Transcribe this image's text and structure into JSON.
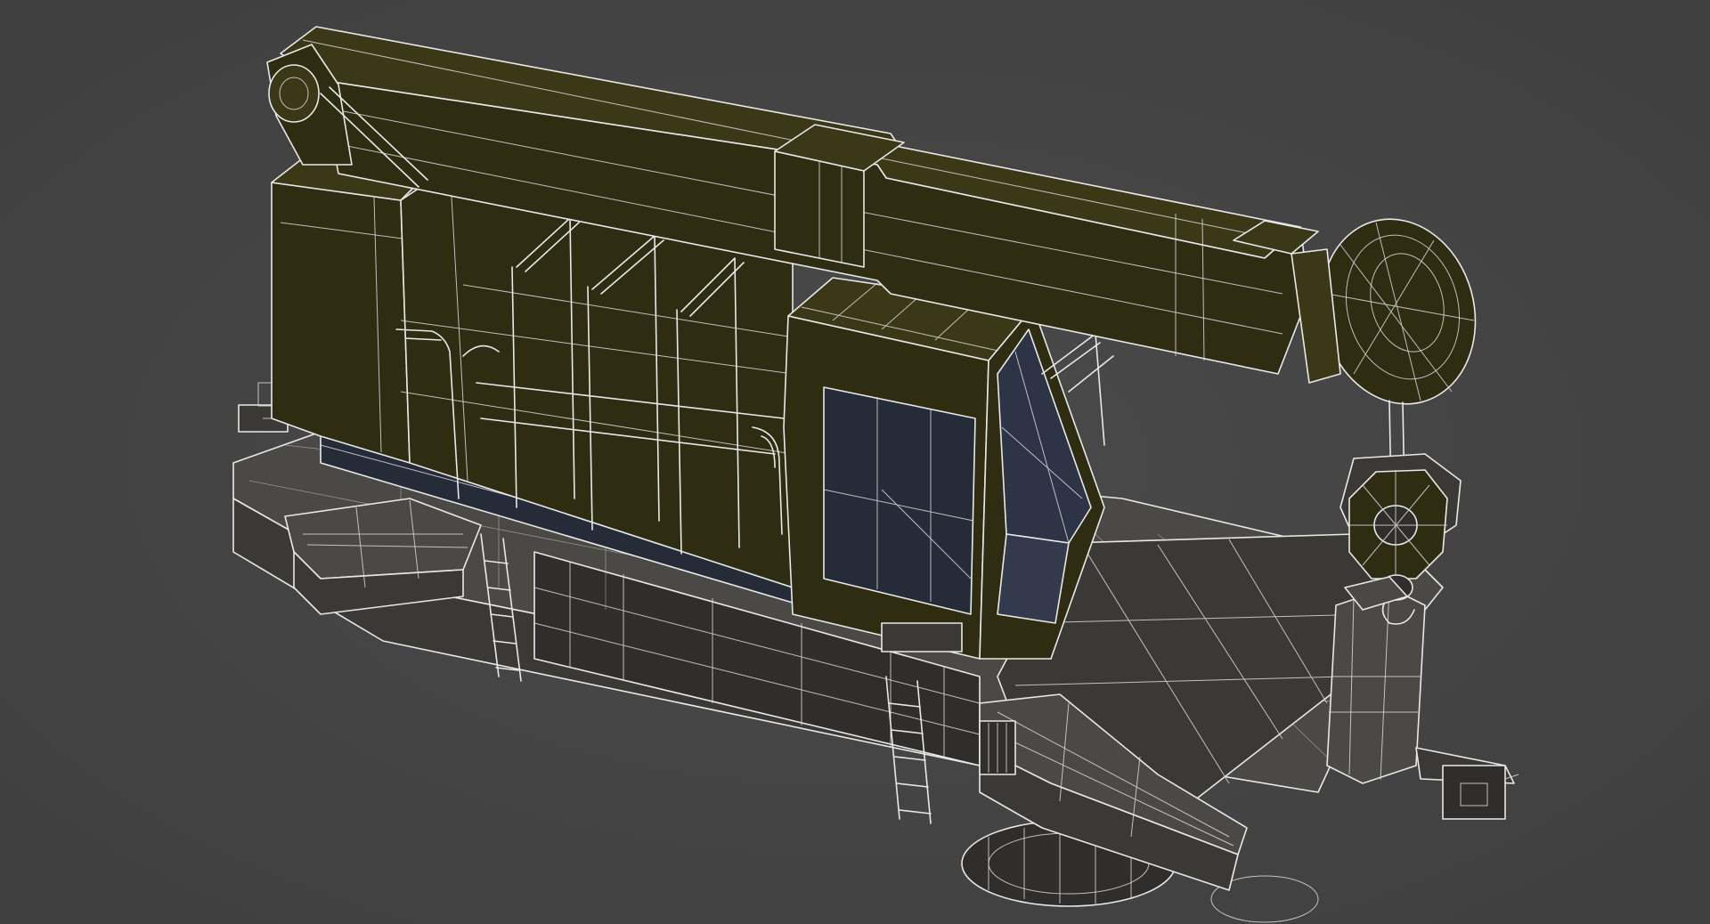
{
  "viewport": {
    "background_color": "#444444",
    "mesh_wire_color": "#e8e8e8",
    "crane_body_color": "#2e2d12",
    "platform_color": "#3a3936",
    "cab_window_color": "#2d3446"
  }
}
